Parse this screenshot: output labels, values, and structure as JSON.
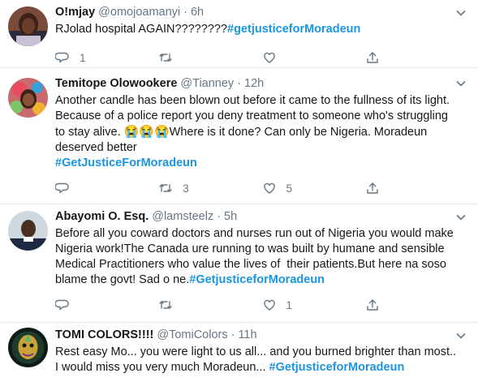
{
  "tweets": [
    {
      "name": "O!mjay",
      "handle": "@omojoamanyi",
      "dot": "·",
      "time": "6h",
      "text": "RJolad hospital AGAIN????????",
      "hashtag": "#getjusticeforMoradeun",
      "reply_count": "1",
      "retweet_count": "",
      "like_count": ""
    },
    {
      "name": "Temitope Olowookere",
      "handle": "@Tianney",
      "dot": "·",
      "time": "12h",
      "text_line1": "Another candle has been blown out before it came to the fullness of its light.",
      "text_line2": "Because of a police report you deny treatment to someone who's struggling",
      "text_line3_a": "to stay alive.",
      "emoji": "😭😭😭",
      "text_line3_b": "Where is it done? Can only be Nigeria. Moradeun",
      "text_line4": "deserved better",
      "hashtag": "#GetJusticeForMoradeun",
      "reply_count": "",
      "retweet_count": "3",
      "like_count": "5"
    },
    {
      "name": "Abayomi O. Esq.",
      "handle": "@lamsteelz",
      "dot": "·",
      "time": "5h",
      "text_line1": "Before all you coward doctors and nurses run out of Nigeria you would make",
      "text_line2": "Nigeria work!The Canada ure running to was built by humane and sensible",
      "text_line3": "Medical Practitioners who value the lives of  their patients.But here na soso",
      "text_line4": "blame the govt! Sad o ne.",
      "hashtag": "#GetjusticeforMoradeun",
      "reply_count": "",
      "retweet_count": "",
      "like_count": "1"
    },
    {
      "name": "TOMI COLORS!!!!",
      "handle": "@TomiColors",
      "dot": "·",
      "time": "11h",
      "text_line1": "Rest easy Mo... you were light to us all... and you burned brighter than most..",
      "text_line2": "I would miss you very much Moradeun...",
      "hashtag": "#GetjusticeforMoradeun"
    }
  ],
  "icons": {
    "reply": "reply-icon",
    "retweet": "retweet-icon",
    "like": "heart-icon",
    "share": "share-icon",
    "more": "chevron-down-icon"
  },
  "colors": {
    "hashtag": "#1b95e0",
    "muted": "#657786",
    "divider": "#e6ecf0"
  }
}
